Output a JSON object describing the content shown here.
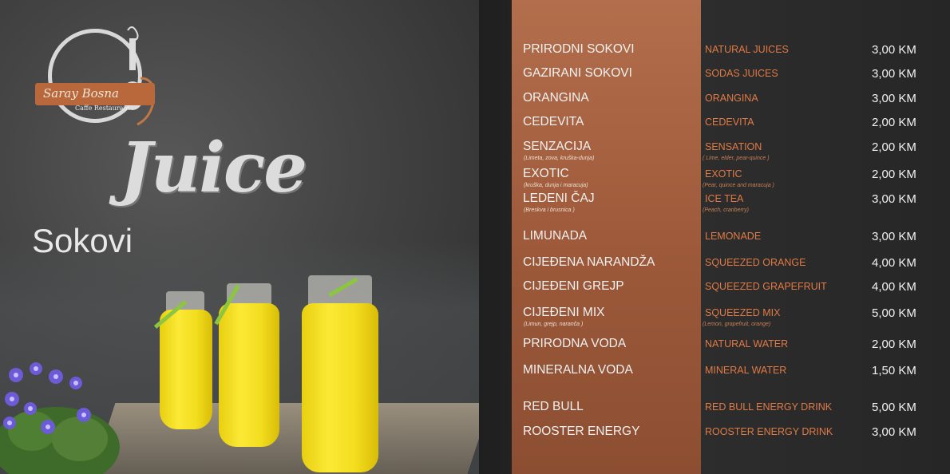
{
  "brand": {
    "name": "Saray Bosna",
    "tagline": "Caffe Restaurant"
  },
  "heading": {
    "script_title": "Juice",
    "subtitle": "Sokovi"
  },
  "menu": {
    "items": [
      {
        "name": "PRIRODNI SOKOVI",
        "note": "",
        "en": "NATURAL JUICES",
        "en_note": "",
        "price": "3,00 KM"
      },
      {
        "name": "GAZIRANI SOKOVI",
        "note": "",
        "en": "SODAS JUICES",
        "en_note": "",
        "price": "3,00 KM"
      },
      {
        "name": "ORANGINA",
        "note": "",
        "en": "ORANGINA",
        "en_note": "",
        "price": "3,00 KM"
      },
      {
        "name": "CEDEVITA",
        "note": "",
        "en": "CEDEVITA",
        "en_note": "",
        "price": "2,00 KM"
      },
      {
        "name": "SENZACIJA",
        "note": "(Limeta, zova, kruška-dunja)",
        "en": "SENSATION",
        "en_note": "( Lime, elder, pear-quince )",
        "price": "2,00 KM"
      },
      {
        "name": "EXOTIC",
        "note": "(kruška, dunja i maracuja)",
        "en": "EXOTIC",
        "en_note": "(Pear, quince and maracuja )",
        "price": "2,00 KM"
      },
      {
        "name": "LEDENI ČAJ",
        "note": "(Breskva i brusnica )",
        "en": "ICE TEA",
        "en_note": "(Peach, cranberry)",
        "price": "3,00 KM"
      },
      {
        "name": "LIMUNADA",
        "note": "",
        "en": "LEMONADE",
        "en_note": "",
        "price": "3,00 KM"
      },
      {
        "name": "CIJEĐENA NARANDŽA",
        "note": "",
        "en": "SQUEEZED ORANGE",
        "en_note": "",
        "price": "4,00 KM"
      },
      {
        "name": "CIJEĐENI GREJP",
        "note": "",
        "en": "SQUEEZED GRAPEFRUIT",
        "en_note": "",
        "price": "4,00 KM"
      },
      {
        "name": "CIJEĐENI MIX",
        "note": "(Limun, grejp, naranča )",
        "en": "SQUEEZED MIX",
        "en_note": "(Lemon, grapefruit, orange)",
        "price": "5,00 KM"
      },
      {
        "name": "PRIRODNA VODA",
        "note": "",
        "en": "NATURAL WATER",
        "en_note": "",
        "price": "2,00 KM"
      },
      {
        "name": "MINERALNA VODA",
        "note": "",
        "en": "MINERAL WATER",
        "en_note": "",
        "price": "1,50 KM"
      },
      {
        "name": "RED BULL",
        "note": "",
        "en": "RED BULL ENERGY DRINK",
        "en_note": "",
        "price": "5,00 KM"
      },
      {
        "name": "ROOSTER ENERGY",
        "note": "",
        "en": "ROOSTER ENERGY DRINK",
        "en_note": "",
        "price": "3,00 KM"
      }
    ]
  },
  "colors": {
    "band": "#a6603f",
    "english_text": "#e07a45",
    "chalk_text": "#f1f1f1"
  }
}
